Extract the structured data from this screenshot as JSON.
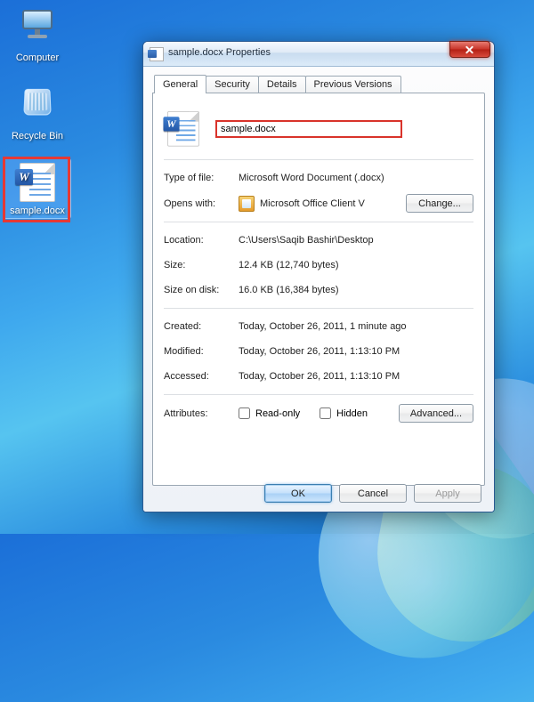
{
  "desktop": {
    "icons": {
      "computer": "Computer",
      "recycle_bin": "Recycle Bin",
      "sample_docx": "sample.docx"
    }
  },
  "dialog": {
    "title": "sample.docx Properties",
    "tabs": {
      "general": "General",
      "security": "Security",
      "details": "Details",
      "previous_versions": "Previous Versions"
    },
    "filename": "sample.docx",
    "rows": {
      "type_of_file": {
        "label": "Type of file:",
        "value": "Microsoft Word Document (.docx)"
      },
      "opens_with": {
        "label": "Opens with:",
        "value": "Microsoft Office Client V",
        "change_btn": "Change..."
      },
      "location": {
        "label": "Location:",
        "value": "C:\\Users\\Saqib Bashir\\Desktop"
      },
      "size": {
        "label": "Size:",
        "value": "12.4 KB (12,740 bytes)"
      },
      "size_on_disk": {
        "label": "Size on disk:",
        "value": "16.0 KB (16,384 bytes)"
      },
      "created": {
        "label": "Created:",
        "value": "Today, October 26, 2011, 1 minute ago"
      },
      "modified": {
        "label": "Modified:",
        "value": "Today, October 26, 2011, 1:13:10 PM"
      },
      "accessed": {
        "label": "Accessed:",
        "value": "Today, October 26, 2011, 1:13:10 PM"
      },
      "attributes": {
        "label": "Attributes:",
        "readonly": "Read-only",
        "hidden": "Hidden",
        "advanced_btn": "Advanced..."
      }
    },
    "buttons": {
      "ok": "OK",
      "cancel": "Cancel",
      "apply": "Apply"
    }
  }
}
